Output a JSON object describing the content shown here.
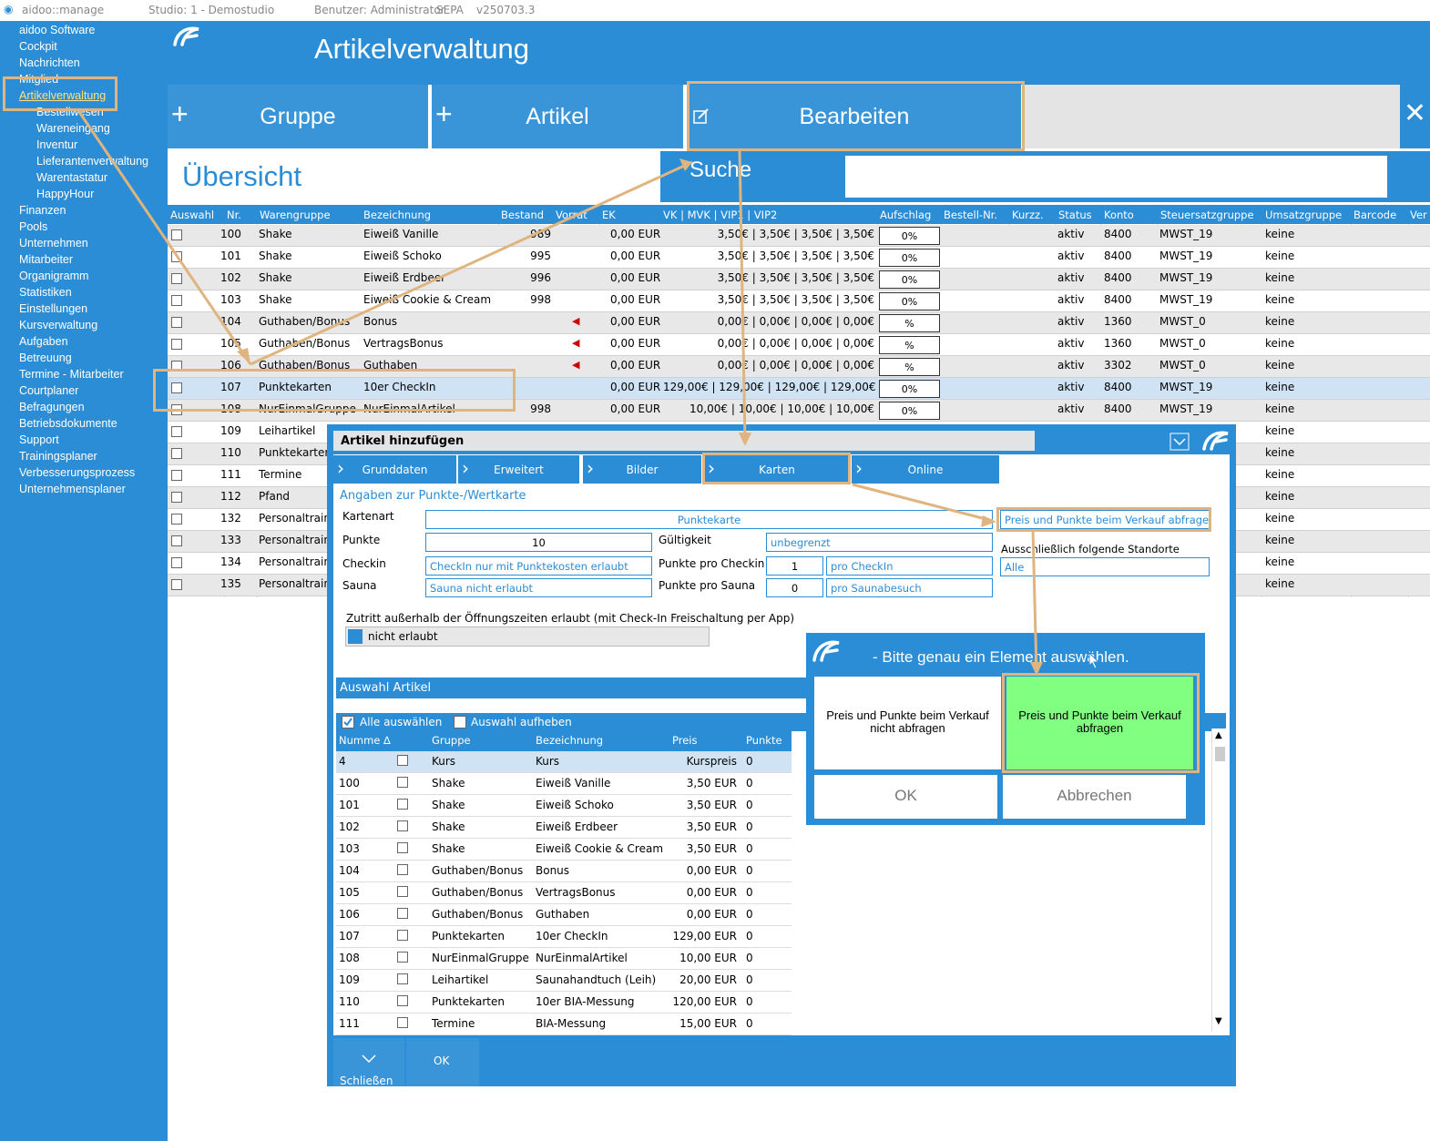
{
  "titlebar": {
    "app": "aidoo::manage",
    "studio": "Studio: 1 - Demostudio",
    "user": "Benutzer: Administrator",
    "sepa": "SEPA",
    "version": "v250703.3"
  },
  "sidebar": {
    "items": [
      "aidoo Software",
      "Cockpit",
      "Nachrichten",
      "Mitglied",
      "Artikelverwaltung",
      "Bestellwesen",
      "Wareneingang",
      "Inventur",
      "Lieferantenverwaltung",
      "Warentastatur",
      "HappyHour",
      "Finanzen",
      "Pools",
      "Unternehmen",
      "Mitarbeiter",
      "Organigramm",
      "Statistiken",
      "Einstellungen",
      "Kursverwaltung",
      "Aufgaben",
      "Betreuung",
      "Termine - Mitarbeiter",
      "Courtplaner",
      "Befragungen",
      "Betriebsdokumente",
      "Support",
      "Trainingsplaner",
      "Verbesserungsprozess",
      "Unternehmensplaner"
    ]
  },
  "header": {
    "title": "Artikelverwaltung"
  },
  "toolbar": {
    "gruppe": "Gruppe",
    "artikel": "Artikel",
    "bearbeiten": "Bearbeiten",
    "plus": "+",
    "close": "✕"
  },
  "overview": {
    "title": "Übersicht",
    "search_label": "Suche",
    "search_value": ""
  },
  "table": {
    "headers": [
      "Auswahl",
      "Nr.",
      "Warengruppe",
      "Bezeichnung",
      "Bestand",
      "Vorrat",
      "EK",
      "VK | MVK | VIP1 | VIP2",
      "Aufschlag",
      "Bestell-Nr.",
      "Kurzz.",
      "Status",
      "Konto",
      "Steuersatzgruppe",
      "Umsatzgruppe",
      "Barcode",
      "Ver"
    ],
    "rows": [
      {
        "nr": "100",
        "gruppe": "Shake",
        "bez": "Eiweiß Vanille",
        "bestand": "989",
        "ek": "0,00 EUR",
        "vk": "3,50€ | 3,50€ | 3,50€ | 3,50€",
        "auf": "0%",
        "status": "aktiv",
        "konto": "8400",
        "steuer": "MWST_19",
        "umsatz": "keine"
      },
      {
        "nr": "101",
        "gruppe": "Shake",
        "bez": "Eiweiß Schoko",
        "bestand": "995",
        "ek": "0,00 EUR",
        "vk": "3,50€ | 3,50€ | 3,50€ | 3,50€",
        "auf": "0%",
        "status": "aktiv",
        "konto": "8400",
        "steuer": "MWST_19",
        "umsatz": "keine"
      },
      {
        "nr": "102",
        "gruppe": "Shake",
        "bez": "Eiweiß Erdbeer",
        "bestand": "996",
        "ek": "0,00 EUR",
        "vk": "3,50€ | 3,50€ | 3,50€ | 3,50€",
        "auf": "0%",
        "status": "aktiv",
        "konto": "8400",
        "steuer": "MWST_19",
        "umsatz": "keine"
      },
      {
        "nr": "103",
        "gruppe": "Shake",
        "bez": "Eiweiß Cookie & Cream",
        "bestand": "998",
        "ek": "0,00 EUR",
        "vk": "3,50€ | 3,50€ | 3,50€ | 3,50€",
        "auf": "0%",
        "status": "aktiv",
        "konto": "8400",
        "steuer": "MWST_19",
        "umsatz": "keine"
      },
      {
        "nr": "104",
        "gruppe": "Guthaben/Bonus",
        "bez": "Bonus",
        "bestand": "",
        "ek": "0,00 EUR",
        "vk": "0,00€ | 0,00€ | 0,00€ | 0,00€",
        "auf": "%",
        "status": "aktiv",
        "konto": "1360",
        "steuer": "MWST_0",
        "umsatz": "keine"
      },
      {
        "nr": "105",
        "gruppe": "Guthaben/Bonus",
        "bez": "VertragsBonus",
        "bestand": "",
        "ek": "0,00 EUR",
        "vk": "0,00€ | 0,00€ | 0,00€ | 0,00€",
        "auf": "%",
        "status": "aktiv",
        "konto": "1360",
        "steuer": "MWST_0",
        "umsatz": "keine"
      },
      {
        "nr": "106",
        "gruppe": "Guthaben/Bonus",
        "bez": "Guthaben",
        "bestand": "",
        "ek": "0,00 EUR",
        "vk": "0,00€ | 0,00€ | 0,00€ | 0,00€",
        "auf": "%",
        "status": "aktiv",
        "konto": "3302",
        "steuer": "MWST_0",
        "umsatz": "keine"
      },
      {
        "nr": "107",
        "gruppe": "Punktekarten",
        "bez": "10er CheckIn",
        "bestand": "",
        "ek": "0,00 EUR",
        "vk": "129,00€ | 129,00€ | 129,00€ | 129,00€",
        "auf": "0%",
        "status": "aktiv",
        "konto": "8400",
        "steuer": "MWST_19",
        "umsatz": "keine"
      },
      {
        "nr": "108",
        "gruppe": "NurEinmalGruppe",
        "bez": "NurEinmalArtikel",
        "bestand": "998",
        "ek": "0,00 EUR",
        "vk": "10,00€ | 10,00€ | 10,00€ | 10,00€",
        "auf": "0%",
        "status": "aktiv",
        "konto": "8400",
        "steuer": "MWST_19",
        "umsatz": "keine"
      },
      {
        "nr": "109",
        "gruppe": "Leihartikel",
        "umsatz": "keine"
      },
      {
        "nr": "110",
        "gruppe": "Punktekarten",
        "umsatz": "keine"
      },
      {
        "nr": "111",
        "gruppe": "Termine",
        "umsatz": "keine"
      },
      {
        "nr": "112",
        "gruppe": "Pfand",
        "umsatz": "keine"
      },
      {
        "nr": "132",
        "gruppe": "Personaltrain",
        "umsatz": "keine"
      },
      {
        "nr": "133",
        "gruppe": "Personaltrain",
        "umsatz": "keine"
      },
      {
        "nr": "134",
        "gruppe": "Personaltrain",
        "umsatz": "keine"
      },
      {
        "nr": "135",
        "gruppe": "Personaltrain",
        "umsatz": "keine"
      }
    ]
  },
  "dialog": {
    "title": "Artikel hinzufügen",
    "tabs": [
      "Grunddaten",
      "Erweitert",
      "Bilder",
      "Karten",
      "Online"
    ],
    "section": "Angaben zur Punkte-/Wertkarte",
    "kartenart_label": "Kartenart",
    "kartenart_value": "Punktekarte",
    "punkte_label": "Punkte",
    "punkte_value": "10",
    "gueltigkeit_label": "Gültigkeit",
    "gueltigkeit_value": "unbegrenzt",
    "checkin_label": "Checkin",
    "checkin_value": "CheckIn nur mit Punktekosten erlaubt",
    "ppc_label": "Punkte pro Checkin",
    "ppc_value": "1",
    "ppc_unit": "pro CheckIn",
    "sauna_label": "Sauna",
    "sauna_value": "Sauna nicht erlaubt",
    "pps_label": "Punkte pro Sauna",
    "pps_value": "0",
    "pps_unit": "pro Saunabesuch",
    "verkauf_value": "Preis und Punkte beim Verkauf abfragen",
    "standorte_label": "Ausschließlich folgende Standorte",
    "standorte_value": "Alle",
    "zutritt_label": "Zutritt außerhalb der Öffnungszeiten erlaubt (mit Check-In Freischaltung per App)",
    "zutritt_value": "nicht erlaubt",
    "auswahl_header": "Auswahl Artikel",
    "alle_auswaehlen": "Alle auswählen",
    "auswahl_aufheben": "Auswahl aufheben",
    "cols": [
      "Numme ∆",
      "Gruppe",
      "Bezeichnung",
      "Preis",
      "Punkte"
    ],
    "items": [
      [
        "4",
        "Kurs",
        "Kurs",
        "Kurspreis",
        "0"
      ],
      [
        "100",
        "Shake",
        "Eiweiß Vanille",
        "3,50 EUR",
        "0"
      ],
      [
        "101",
        "Shake",
        "Eiweiß Schoko",
        "3,50 EUR",
        "0"
      ],
      [
        "102",
        "Shake",
        "Eiweiß Erdbeer",
        "3,50 EUR",
        "0"
      ],
      [
        "103",
        "Shake",
        "Eiweiß Cookie & Cream",
        "3,50 EUR",
        "0"
      ],
      [
        "104",
        "Guthaben/Bonus",
        "Bonus",
        "0,00 EUR",
        "0"
      ],
      [
        "105",
        "Guthaben/Bonus",
        "VertragsBonus",
        "0,00 EUR",
        "0"
      ],
      [
        "106",
        "Guthaben/Bonus",
        "Guthaben",
        "0,00 EUR",
        "0"
      ],
      [
        "107",
        "Punktekarten",
        "10er CheckIn",
        "129,00 EUR",
        "0"
      ],
      [
        "108",
        "NurEinmalGruppe",
        "NurEinmalArtikel",
        "10,00 EUR",
        "0"
      ],
      [
        "109",
        "Leihartikel",
        "Saunahandtuch (Leih)",
        "20,00 EUR",
        "0"
      ],
      [
        "110",
        "Punktekarten",
        "10er BIA-Messung",
        "120,00 EUR",
        "0"
      ],
      [
        "111",
        "Termine",
        "BIA-Messung",
        "15,00 EUR",
        "0"
      ]
    ],
    "schliessen": "Schließen",
    "ok": "OK"
  },
  "modal": {
    "title": "- Bitte genau ein Element auswählen.",
    "option1": "Preis und Punkte beim Verkauf nicht abfragen",
    "option2": "Preis und Punkte beim Verkauf abfragen",
    "ok": "OK",
    "cancel": "Abbrechen"
  },
  "colors": {
    "primary": "#2b8dd6",
    "highlight": "#80ff80",
    "annotation": "#e0b47e",
    "alt_row": "#e8e8e8",
    "selected_row": "#cfe3f4"
  }
}
